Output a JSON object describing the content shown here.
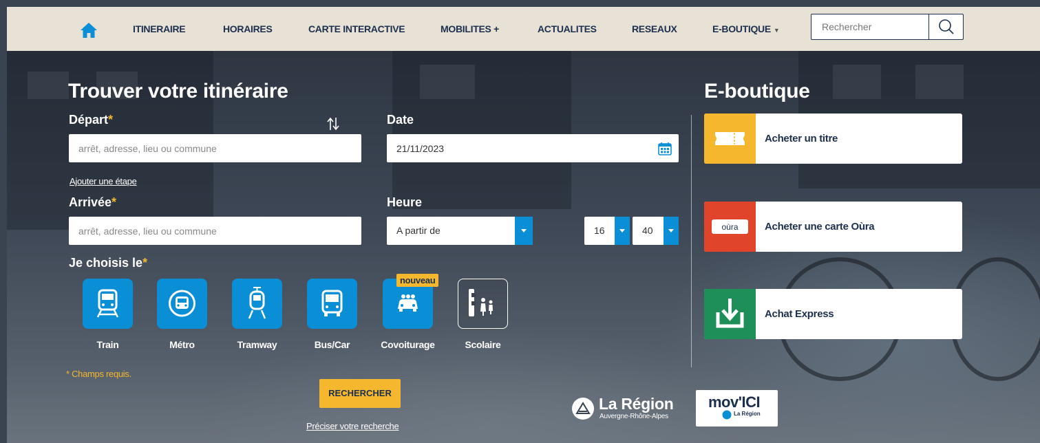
{
  "nav": {
    "items": [
      {
        "label": "ITINERAIRE"
      },
      {
        "label": "HORAIRES"
      },
      {
        "label": "CARTE INTERACTIVE"
      },
      {
        "label": "MOBILITES +"
      },
      {
        "label": "ACTUALITES"
      },
      {
        "label": "RESEAUX"
      },
      {
        "label": "E-BOUTIQUE"
      }
    ],
    "search_placeholder": "Rechercher"
  },
  "itinerary": {
    "title": "Trouver votre itinéraire",
    "depart_label": "Départ",
    "arrivee_label": "Arrivée",
    "required_mark": "*",
    "depart_placeholder": "arrêt, adresse, lieu ou commune",
    "arrivee_placeholder": "arrêt, adresse, lieu ou commune",
    "add_step": "Ajouter une étape",
    "date_label": "Date",
    "date_value": "21/11/2023",
    "heure_label": "Heure",
    "heure_mode": "A partir de",
    "hour": "16",
    "minute": "40",
    "choose_label": "Je choisis le",
    "modes": [
      {
        "label": "Train"
      },
      {
        "label": "Métro"
      },
      {
        "label": "Tramway"
      },
      {
        "label": "Bus/Car"
      },
      {
        "label": "Covoiturage"
      },
      {
        "label": "Scolaire"
      }
    ],
    "new_badge": "nouveau",
    "required_note": "* Champs requis.",
    "search_button": "RECHERCHER",
    "refine_link": "Préciser votre recherche"
  },
  "shop": {
    "title": "E-boutique",
    "cards": [
      {
        "label": "Acheter un titre",
        "color": "#f5b72e"
      },
      {
        "label": "Acheter une carte Oùra",
        "color": "#e0442a",
        "icon_text": "oùra"
      },
      {
        "label": "Achat Express",
        "color": "#1f8f5a"
      }
    ]
  },
  "logos": {
    "region_name": "La Région",
    "region_sub": "Auvergne-Rhône-Alpes",
    "movici": "mov'ICI",
    "movici_sub": "La Région"
  },
  "colors": {
    "accent_blue": "#0a8fd6",
    "accent_yellow": "#f5b72e",
    "navy": "#1c2f4d"
  }
}
